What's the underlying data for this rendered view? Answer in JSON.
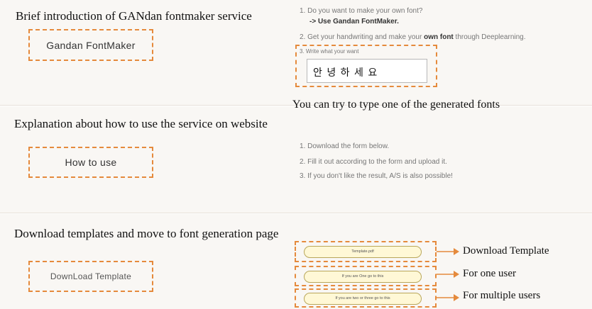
{
  "section1": {
    "caption": "Brief introduction of GANdan fontmaker service",
    "box_label": "Gandan FontMaker",
    "steps": [
      "1. Do you want to make your own font?",
      "-> Use Gandan FontMaker.",
      "2. Get your handwriting and make your",
      "own font",
      "through Deeplearning.",
      "3. Write what your want"
    ],
    "input_value": "안 녕 하 세 요",
    "note": "You can try to type one of the generated fonts"
  },
  "section2": {
    "caption": "Explanation about how to use the service on website",
    "box_label": "How to use",
    "steps": [
      "1. Download the form below.",
      "2. Fill it out according to the form and upload it.",
      "3. If you don't like the result, A/S is also possible!"
    ]
  },
  "section3": {
    "caption": "Download templates and move to font generation page",
    "box_label": "DownLoad Template",
    "buttons": [
      {
        "label": "Template.pdf",
        "annotation": "Download Template"
      },
      {
        "label": "If you are One go to this",
        "annotation": "For one user"
      },
      {
        "label": "If you are two or three go to this",
        "annotation": "For multiple users"
      }
    ]
  },
  "colors": {
    "accent": "#e58a3c",
    "pill_fill": "#fff8d6",
    "band": "#f9f7f4"
  }
}
